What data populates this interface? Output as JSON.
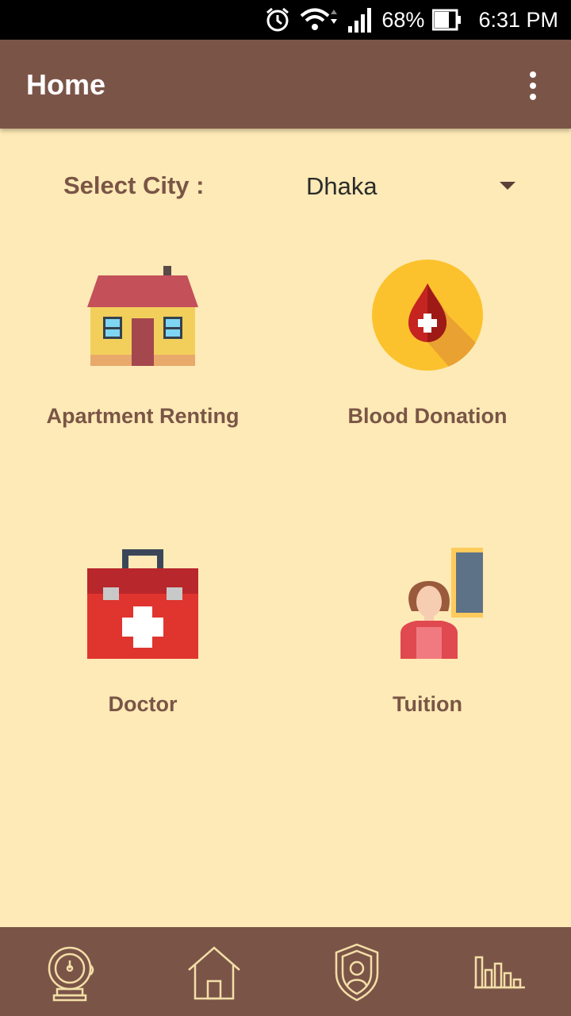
{
  "status_bar": {
    "battery": "68%",
    "time": "6:31 PM",
    "icons": [
      "alarm-icon",
      "wifi-icon",
      "cellular-signal-icon",
      "battery-icon"
    ]
  },
  "app_bar": {
    "title": "Home",
    "menu_icon": "more-vert-icon"
  },
  "city_selector": {
    "label": "Select City :",
    "selected": "Dhaka"
  },
  "tiles": [
    {
      "label": "Apartment Renting",
      "icon": "house-icon"
    },
    {
      "label": "Blood Donation",
      "icon": "blood-drop-icon"
    },
    {
      "label": "Doctor",
      "icon": "first-aid-kit-icon"
    },
    {
      "label": "Tuition",
      "icon": "teacher-icon"
    }
  ],
  "bottom_nav": [
    {
      "icon": "alarm-bell-icon"
    },
    {
      "icon": "home-icon"
    },
    {
      "icon": "user-shield-icon"
    },
    {
      "icon": "bar-chart-icon"
    }
  ],
  "colors": {
    "background": "#FDEAB6",
    "primary": "#7B5448",
    "label_text": "#7A5546",
    "nav_icon": "#F3DFA7"
  }
}
